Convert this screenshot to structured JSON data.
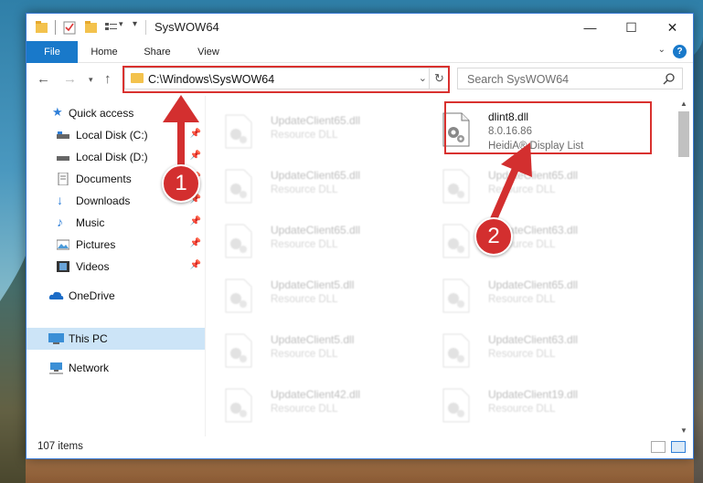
{
  "window": {
    "title": "SysWOW64",
    "controls": {
      "minimize": "—",
      "maximize": "☐",
      "close": "✕"
    }
  },
  "ribbon": {
    "tabs": [
      {
        "label": "File"
      },
      {
        "label": "Home"
      },
      {
        "label": "Share"
      },
      {
        "label": "View"
      }
    ],
    "help": "?"
  },
  "address": {
    "path": "C:\\Windows\\SysWOW64",
    "search_placeholder": "Search SysWOW64"
  },
  "sidebar": {
    "items": [
      {
        "label": "Quick access",
        "icon": "star-icon"
      },
      {
        "label": "Local Disk (C:)",
        "icon": "drive-icon",
        "pinned": true
      },
      {
        "label": "Local Disk (D:)",
        "icon": "drive-icon",
        "pinned": true
      },
      {
        "label": "Documents",
        "icon": "documents-icon",
        "pinned": true
      },
      {
        "label": "Downloads",
        "icon": "download-icon",
        "pinned": true
      },
      {
        "label": "Music",
        "icon": "music-icon",
        "pinned": true
      },
      {
        "label": "Pictures",
        "icon": "pictures-icon",
        "pinned": true
      },
      {
        "label": "Videos",
        "icon": "videos-icon",
        "pinned": true
      },
      {
        "label": "OneDrive",
        "icon": "cloud-icon"
      },
      {
        "label": "This PC",
        "icon": "computer-icon",
        "selected": true
      },
      {
        "label": "Network",
        "icon": "network-icon"
      }
    ]
  },
  "files": {
    "highlighted": {
      "name": "dlint8.dll",
      "version": "8.0.16.86",
      "description": "HeidiA® Display List"
    },
    "left_column": [
      {
        "name": "UpdateClient65.dll",
        "desc": "Resource DLL"
      },
      {
        "name": "UpdateClient65.dll",
        "desc": "Resource DLL"
      },
      {
        "name": "UpdateClient65.dll",
        "desc": "Resource DLL"
      },
      {
        "name": "UpdateClient5.dll",
        "desc": "Resource DLL"
      },
      {
        "name": "UpdateClient5.dll",
        "desc": "Resource DLL"
      },
      {
        "name": "UpdateClient42.dll",
        "desc": "Resource DLL"
      }
    ],
    "right_column": [
      {
        "name": "UpdateClient65.dll",
        "desc": "Resource DLL"
      },
      {
        "name": "UpdateClient63.dll",
        "desc": "Resource DLL"
      },
      {
        "name": "UpdateClient65.dll",
        "desc": "Resource DLL"
      },
      {
        "name": "UpdateClient63.dll",
        "desc": "Resource DLL"
      },
      {
        "name": "UpdateClient19.dll",
        "desc": "Resource DLL"
      }
    ]
  },
  "status": {
    "item_count": "107 items"
  },
  "annotations": {
    "marker_1": "1",
    "marker_2": "2"
  },
  "colors": {
    "accent": "#1979ca",
    "highlight": "#d9312f",
    "selected": "#cce4f7"
  }
}
